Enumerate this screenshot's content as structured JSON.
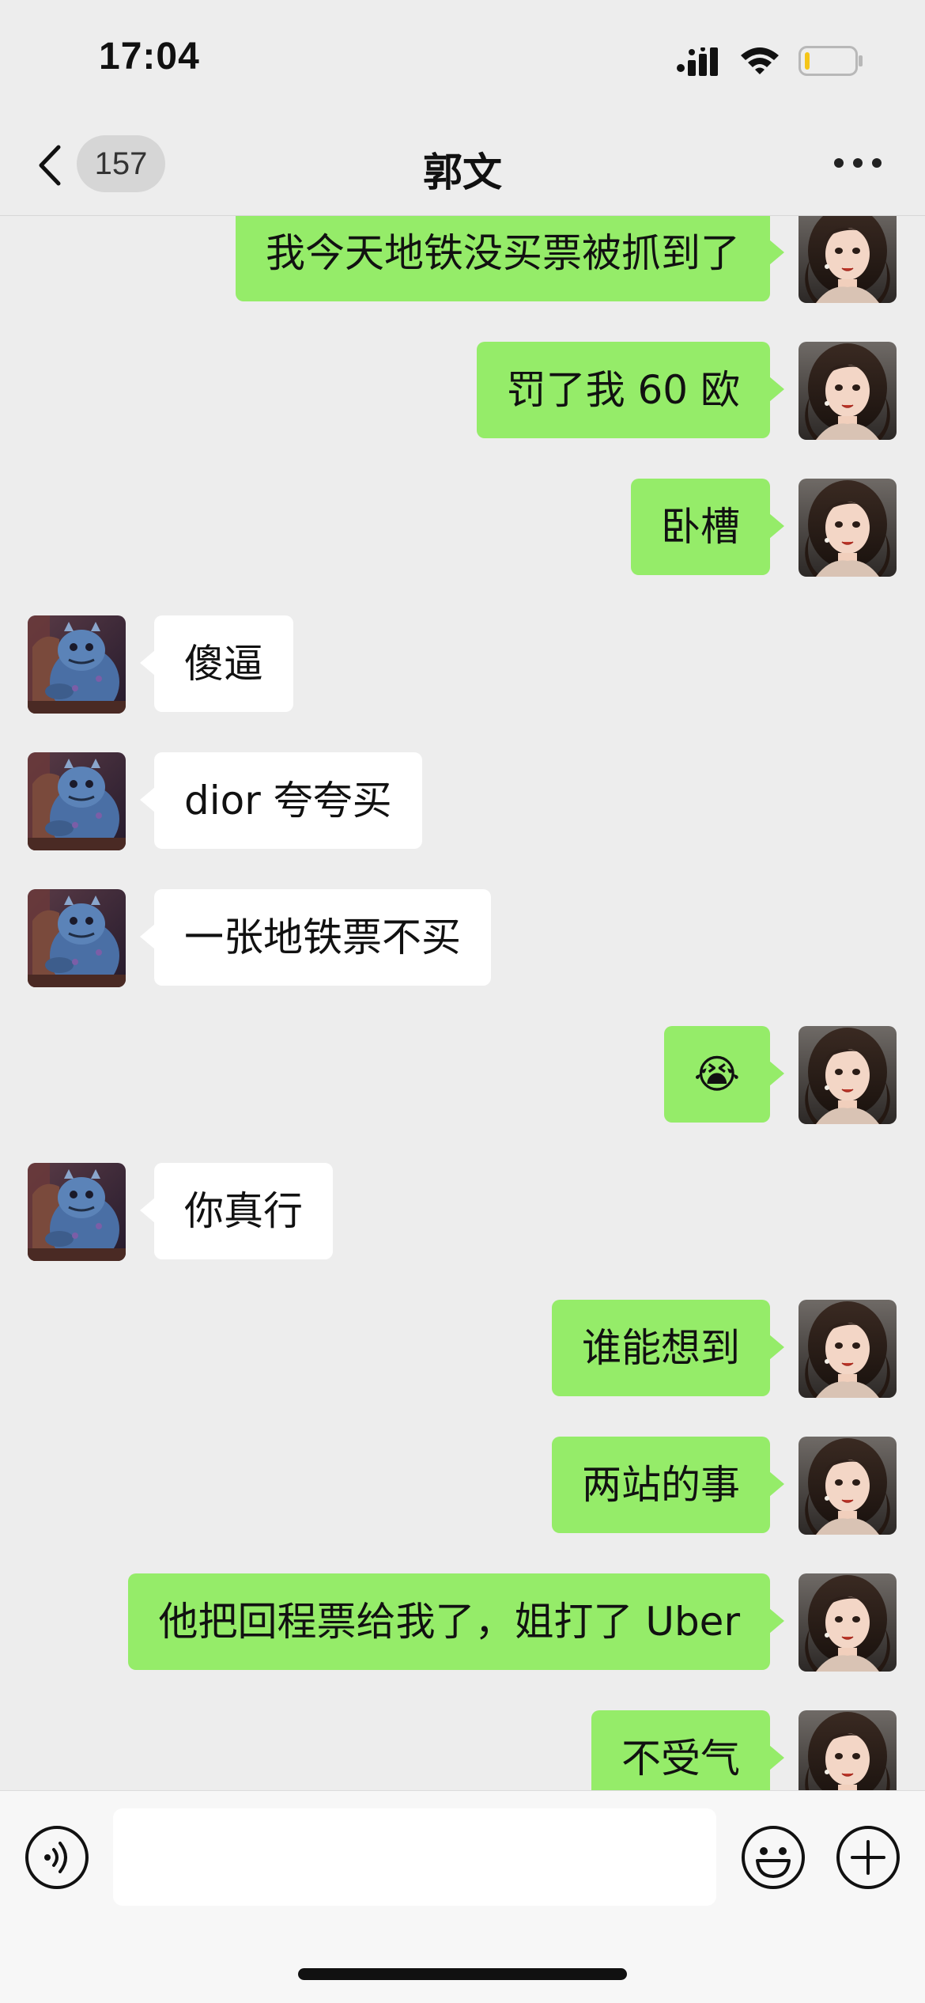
{
  "status_bar": {
    "time": "17:04"
  },
  "header": {
    "unread_count": "157",
    "title": "郭文",
    "icons": [
      "back-chevron-icon",
      "more-dots-icon"
    ]
  },
  "messages": [
    {
      "side": "out",
      "text": "我今天地铁没买票被抓到了"
    },
    {
      "side": "out",
      "text": "罚了我 60 欧"
    },
    {
      "side": "out",
      "text": "卧槽"
    },
    {
      "side": "in",
      "text": "傻逼"
    },
    {
      "side": "in",
      "text": "dior 夸夸买"
    },
    {
      "side": "in",
      "text": "一张地铁票不买"
    },
    {
      "side": "out",
      "text": "😭"
    },
    {
      "side": "in",
      "text": "你真行"
    },
    {
      "side": "out",
      "text": "谁能想到"
    },
    {
      "side": "out",
      "text": "两站的事"
    },
    {
      "side": "out",
      "text": "他把回程票给我了，姐打了 Uber"
    },
    {
      "side": "out",
      "text": "不受气"
    }
  ],
  "input_bar": {
    "text_value": "",
    "icons": [
      "voice-icon",
      "emoji-icon",
      "plus-icon"
    ]
  },
  "colors": {
    "background": "#ededed",
    "outgoing_bubble": "#95ec69",
    "incoming_bubble": "#ffffff",
    "battery_level": "#f5c518"
  }
}
